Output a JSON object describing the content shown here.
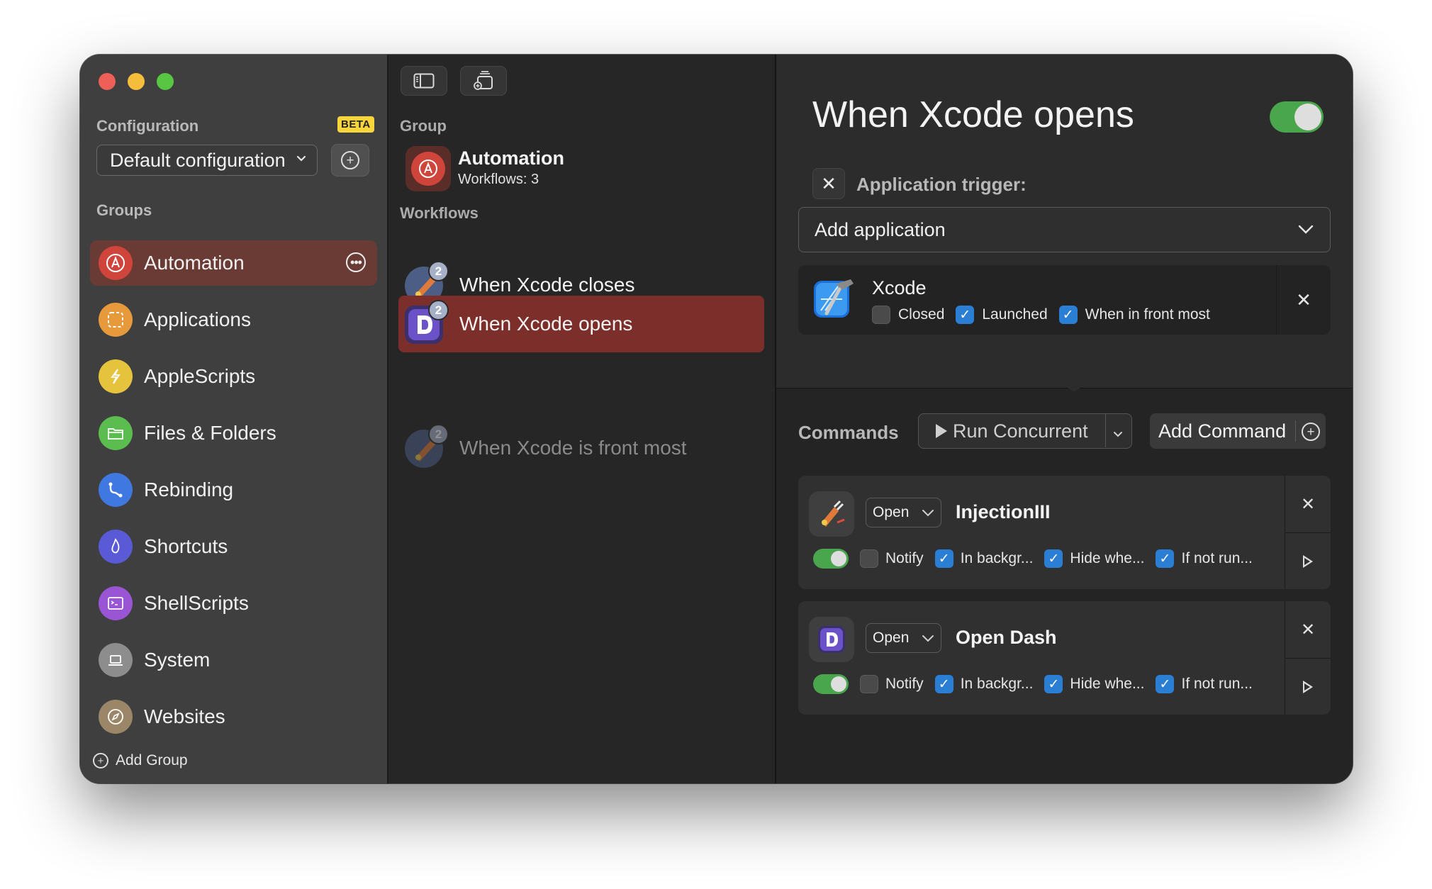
{
  "sidebar": {
    "configuration_label": "Configuration",
    "beta_badge": "BETA",
    "configuration_value": "Default configuration",
    "groups_label": "Groups",
    "groups": [
      {
        "label": "Automation",
        "color": "#d0453b",
        "icon": "automation-icon",
        "selected": true
      },
      {
        "label": "Applications",
        "color": "#e79a3b",
        "icon": "applications-icon"
      },
      {
        "label": "AppleScripts",
        "color": "#e5c33d",
        "icon": "applescripts-icon"
      },
      {
        "label": "Files & Folders",
        "color": "#5bbd4f",
        "icon": "folder-icon"
      },
      {
        "label": "Rebinding",
        "color": "#3f78e0",
        "icon": "rebinding-icon"
      },
      {
        "label": "Shortcuts",
        "color": "#5a59d6",
        "icon": "shortcuts-icon"
      },
      {
        "label": "ShellScripts",
        "color": "#9a55d4",
        "icon": "terminal-icon"
      },
      {
        "label": "System",
        "color": "#8d8d8d",
        "icon": "laptop-icon"
      },
      {
        "label": "Websites",
        "color": "#9b8768",
        "icon": "compass-icon"
      }
    ],
    "add_group_label": "Add Group"
  },
  "middle": {
    "group_label": "Group",
    "group_title": "Automation",
    "group_subtitle": "Workflows: 3",
    "workflows_label": "Workflows",
    "workflows": [
      {
        "label": "When Xcode closes",
        "badge": "2",
        "icon": "injection-icon"
      },
      {
        "label": "When Xcode opens",
        "badge": "2",
        "icon": "dash-icon",
        "selected": true
      },
      {
        "label": "When Xcode is front most",
        "badge": "2",
        "icon": "injection-icon",
        "disabled": true
      }
    ]
  },
  "detail": {
    "title": "When Xcode opens",
    "enabled": true,
    "trigger_label": "Application trigger:",
    "add_application_placeholder": "Add application",
    "app": {
      "name": "Xcode",
      "closed_label": "Closed",
      "launched_label": "Launched",
      "front_label": "When in front most",
      "closed": false,
      "launched": true,
      "front": true
    },
    "commands_label": "Commands",
    "run_mode": "Run Concurrent",
    "add_command_label": "Add Command",
    "commands": [
      {
        "action": "Open",
        "name": "InjectionIII",
        "icon": "injection-icon",
        "notify_label": "Notify",
        "background_label": "In backgr...",
        "hide_label": "Hide whe...",
        "ifnot_label": "If not run..."
      },
      {
        "action": "Open",
        "name": "Open Dash",
        "icon": "dash-icon",
        "notify_label": "Notify",
        "background_label": "In backgr...",
        "hide_label": "Hide whe...",
        "ifnot_label": "If not run..."
      }
    ]
  },
  "colors": {
    "accent_red": "#7c2f2a",
    "toggle_green": "#4aa64c",
    "checkbox_blue": "#2a7ed3"
  }
}
